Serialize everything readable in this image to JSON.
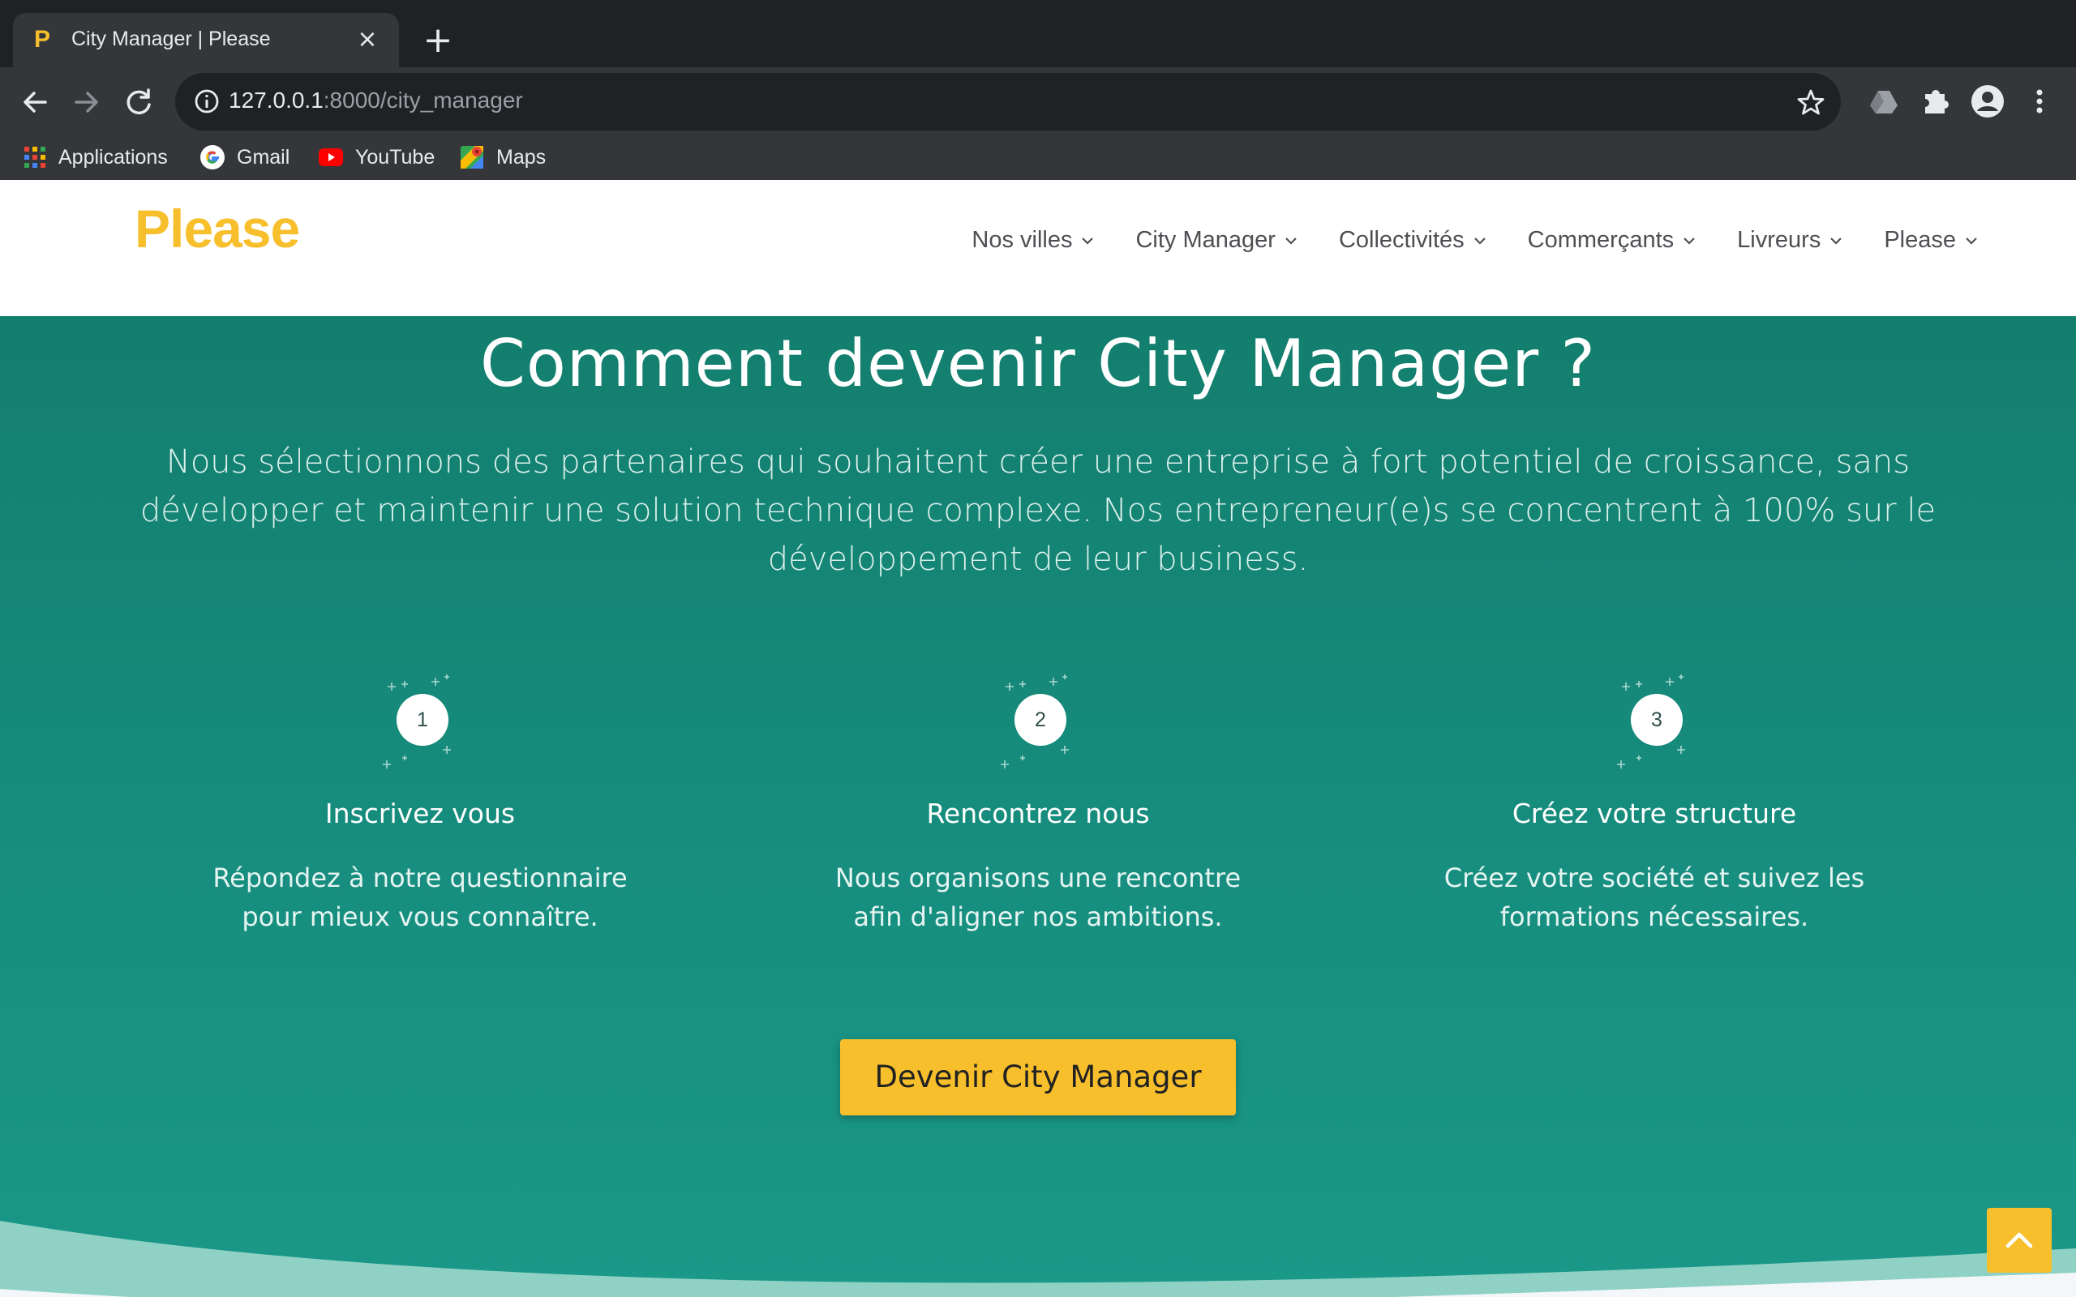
{
  "browser": {
    "tab_title": "City Manager | Please",
    "tab_favicon": "P",
    "url_host": "127.0.0.1",
    "url_rest": ":8000/city_manager",
    "bookmarks": [
      {
        "label": "Applications",
        "icon": "apps-grid-icon"
      },
      {
        "label": "Gmail",
        "icon": "google-icon"
      },
      {
        "label": "YouTube",
        "icon": "youtube-icon"
      },
      {
        "label": "Maps",
        "icon": "maps-icon"
      }
    ]
  },
  "site": {
    "logo": "Please",
    "nav": [
      "Nos villes",
      "City Manager",
      "Collectivités",
      "Commerçants",
      "Livreurs",
      "Please"
    ]
  },
  "hero": {
    "title": "Comment devenir City Manager ?",
    "text": "Nous sélectionnons des partenaires qui souhaitent créer une entreprise à fort potentiel de croissance, sans développer et maintenir une solution technique complexe. Nos entrepreneur(e)s se concentrent à 100% sur le développement de leur business.",
    "steps": [
      {
        "num": "1",
        "title": "Inscrivez vous",
        "desc": "Répondez à notre questionnaire pour mieux vous connaître."
      },
      {
        "num": "2",
        "title": "Rencontrez nous",
        "desc": "Nous organisons une rencontre afin d'aligner nos ambitions."
      },
      {
        "num": "3",
        "title": "Créez votre structure",
        "desc": "Créez votre société et suivez les formations nécessaires."
      }
    ],
    "cta_label": "Devenir City Manager"
  },
  "colors": {
    "brand_yellow": "#f7bf2c",
    "hero_teal": "#178f80",
    "chrome_dark": "#202124"
  }
}
